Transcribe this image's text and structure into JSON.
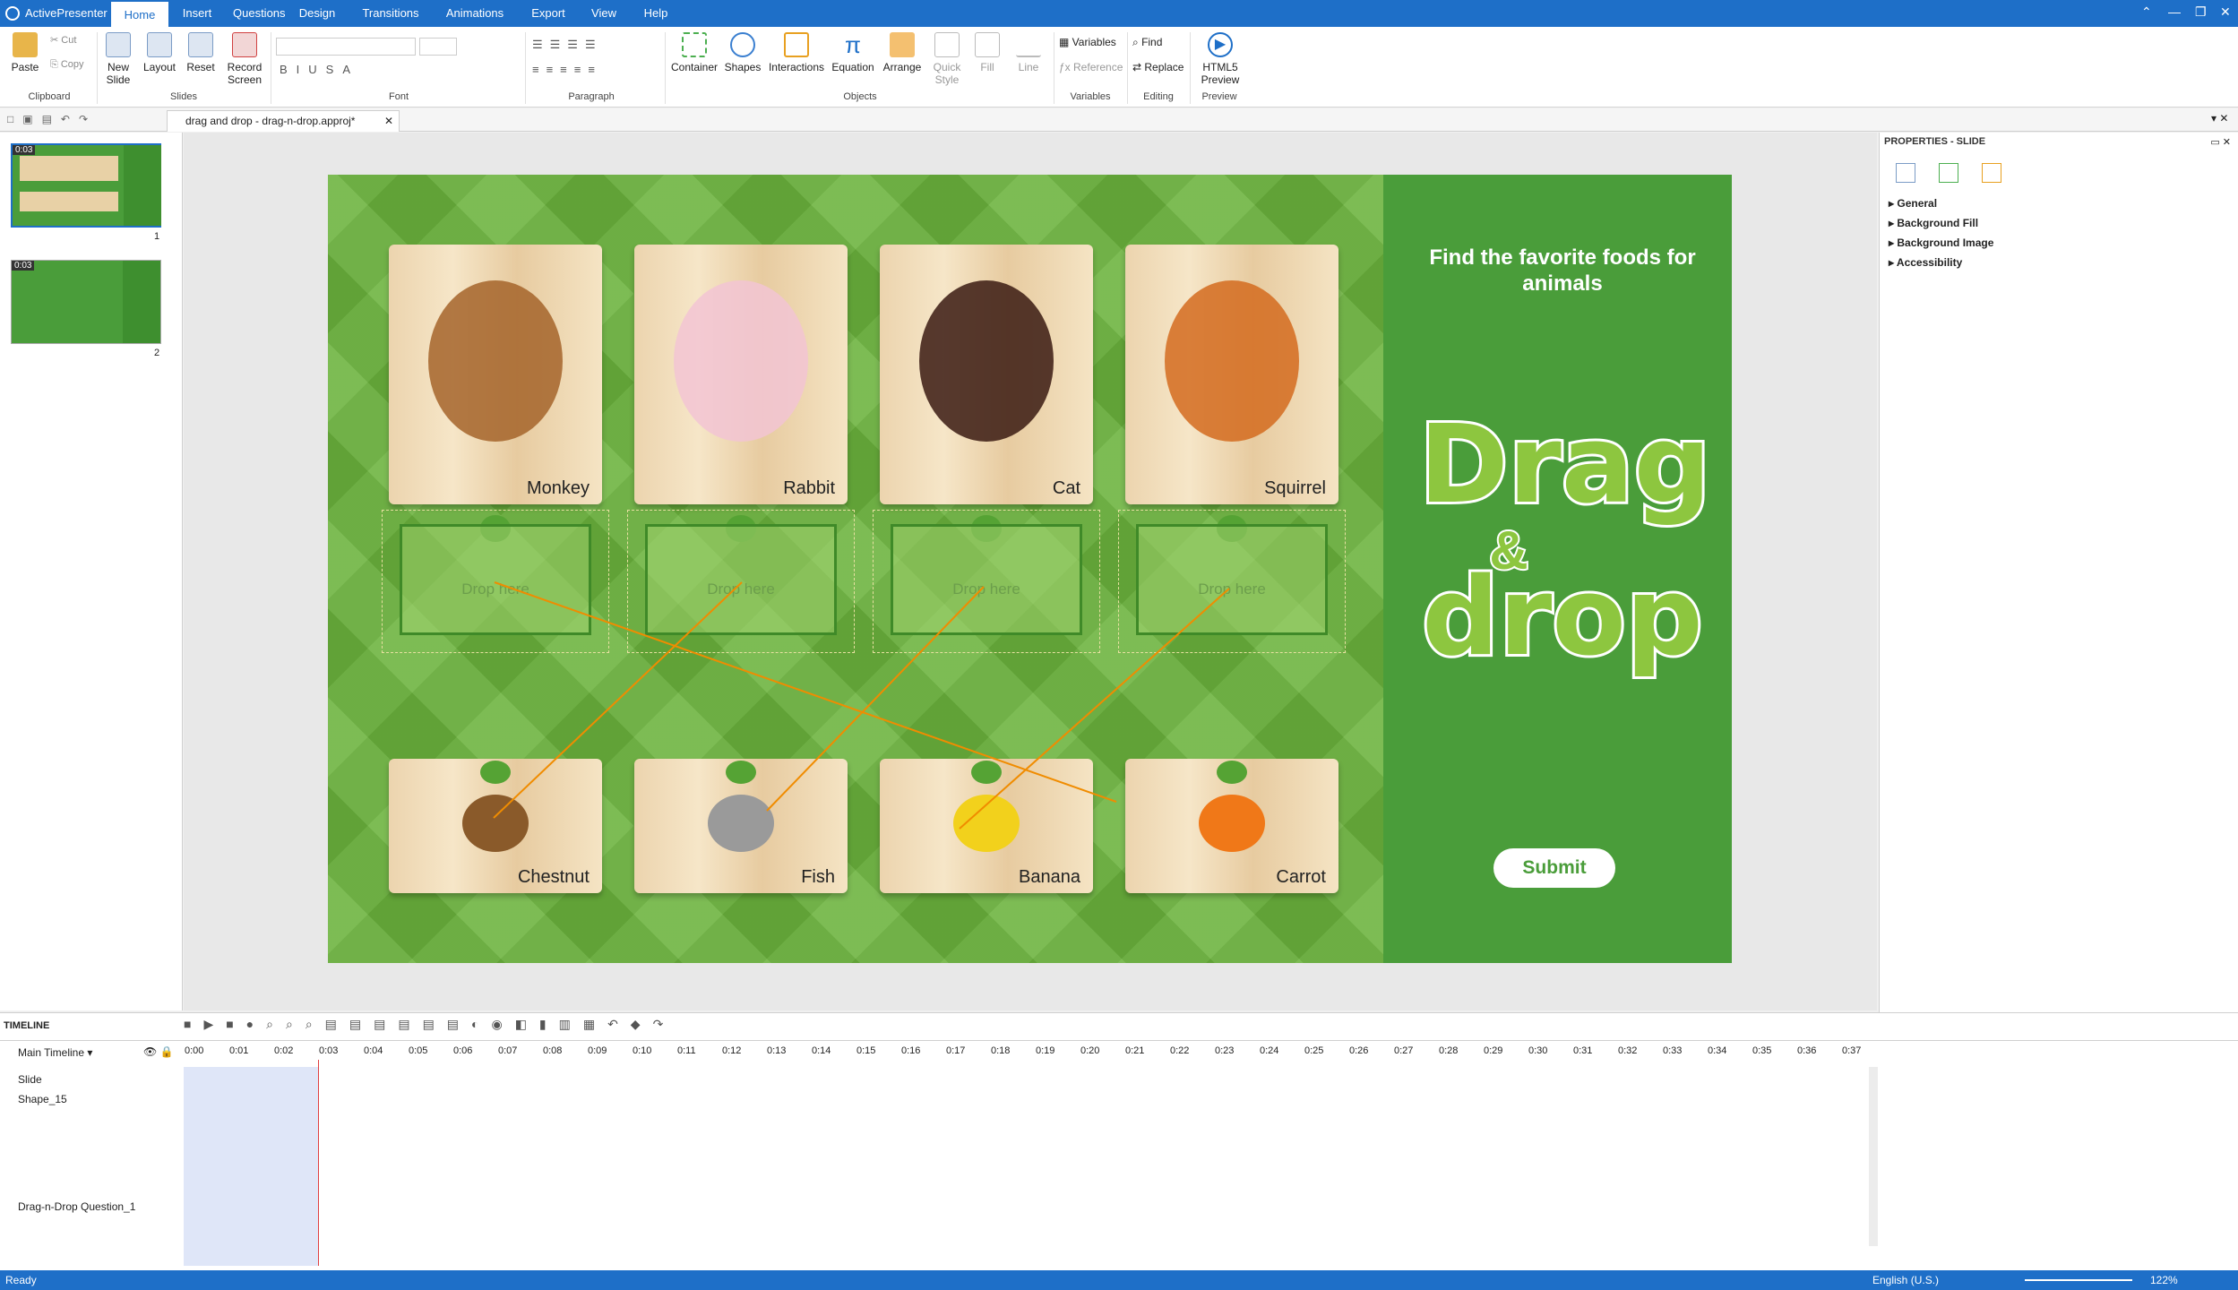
{
  "app": {
    "name": "ActivePresenter"
  },
  "menu_tabs": [
    "Home",
    "Insert",
    "Questions",
    "Design",
    "Transitions",
    "Animations",
    "Export",
    "View",
    "Help"
  ],
  "ribbon": {
    "clipboard": {
      "paste": "Paste",
      "cut": "Cut",
      "copy": "Copy",
      "group": "Clipboard"
    },
    "slides": {
      "new_slide": "New Slide",
      "layout": "Layout",
      "reset": "Reset",
      "record": "Record Screen",
      "group": "Slides"
    },
    "font": {
      "group": "Font"
    },
    "paragraph": {
      "group": "Paragraph"
    },
    "objects": {
      "container": "Container",
      "shapes": "Shapes",
      "interactions": "Interactions",
      "equation": "Equation",
      "arrange": "Arrange",
      "quick_style": "Quick Style",
      "fill": "Fill",
      "line": "Line",
      "group": "Objects"
    },
    "variables": {
      "variables": "Variables",
      "reference": "Reference",
      "group": "Variables"
    },
    "editing": {
      "find": "Find",
      "replace": "Replace",
      "group": "Editing"
    },
    "preview": {
      "html5": "HTML5 Preview",
      "group": "Preview"
    }
  },
  "document_tab": "drag and drop - drag-n-drop.approj*",
  "slides_panel": [
    {
      "duration": "0:03",
      "number": "1"
    },
    {
      "duration": "0:03",
      "number": "2"
    }
  ],
  "slide": {
    "title": "Find the favorite foods for animals",
    "logo_line1": "Drag",
    "logo_amp": "&",
    "logo_line2": "drop",
    "submit": "Submit",
    "animals": [
      "Monkey",
      "Rabbit",
      "Cat",
      "Squirrel"
    ],
    "drop_text": "Drop here",
    "foods": [
      "Chestnut",
      "Fish",
      "Banana",
      "Carrot"
    ],
    "colors": {
      "grass": "#6ab23c",
      "panel": "#4a9d3a",
      "accent": "#8dc63f",
      "line": "#f08c00"
    }
  },
  "properties": {
    "title": "PROPERTIES - SLIDE",
    "sections": [
      "General",
      "Background Fill",
      "Background Image",
      "Accessibility"
    ]
  },
  "timeline": {
    "title": "TIMELINE",
    "main": "Main Timeline",
    "rows": [
      "Slide",
      "Shape_15",
      "Drag-n-Drop Question_1"
    ],
    "ticks": [
      "0:00",
      "0:01",
      "0:02",
      "0:03",
      "0:04",
      "0:05",
      "0:06",
      "0:07",
      "0:08",
      "0:09",
      "0:10",
      "0:11",
      "0:12",
      "0:13",
      "0:14",
      "0:15",
      "0:16",
      "0:17",
      "0:18",
      "0:19",
      "0:20",
      "0:21",
      "0:22",
      "0:23",
      "0:24",
      "0:25",
      "0:26",
      "0:27",
      "0:28",
      "0:29",
      "0:30",
      "0:31",
      "0:32",
      "0:33",
      "0:34",
      "0:35",
      "0:36",
      "0:37"
    ]
  },
  "status": {
    "left": "Ready",
    "language": "English (U.S.)",
    "zoom": "122%"
  }
}
